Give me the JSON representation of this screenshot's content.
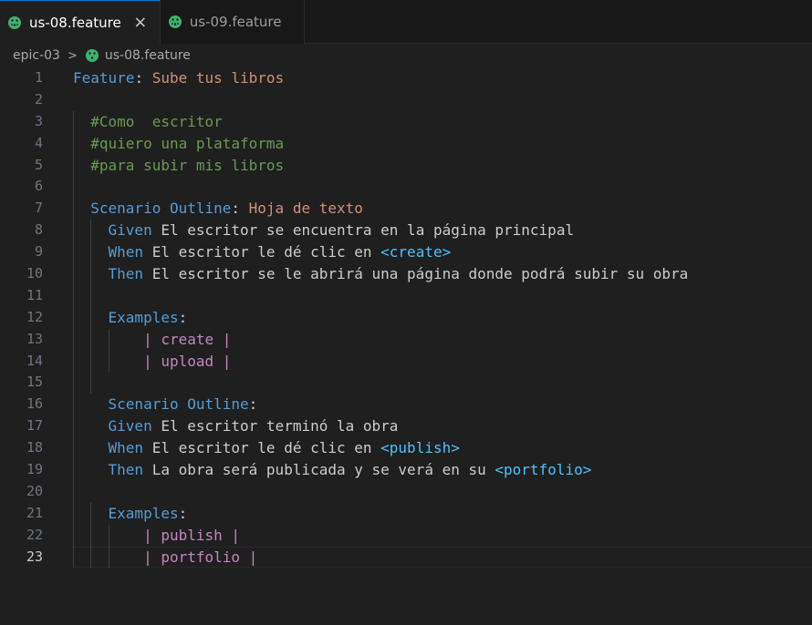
{
  "tabs": [
    {
      "label": "us-08.feature",
      "active": true,
      "close": "×"
    },
    {
      "label": "us-09.feature",
      "active": false
    }
  ],
  "breadcrumb": {
    "folder": "epic-03",
    "separator": ">",
    "file": "us-08.feature"
  },
  "colors": {
    "accent": "#0078d4",
    "keyword": "#569cd6",
    "string": "#ce9178",
    "comment": "#6a9955",
    "placeholder": "#4fc1ff",
    "table": "#c586c0",
    "cucumber_icon": "#3cb371"
  },
  "editor": {
    "current_line": 23,
    "lines": [
      {
        "n": "1",
        "parts": [
          [
            "kw",
            "Feature"
          ],
          [
            "t",
            ": "
          ],
          [
            "title",
            "Sube tus libros"
          ]
        ]
      },
      {
        "n": "2",
        "parts": []
      },
      {
        "n": "3",
        "parts": [
          [
            "t",
            "  "
          ],
          [
            "cmt",
            "#Como  escritor"
          ]
        ]
      },
      {
        "n": "4",
        "parts": [
          [
            "t",
            "  "
          ],
          [
            "cmt",
            "#quiero una plataforma"
          ]
        ]
      },
      {
        "n": "5",
        "parts": [
          [
            "t",
            "  "
          ],
          [
            "cmt",
            "#para subir mis libros"
          ]
        ]
      },
      {
        "n": "6",
        "parts": []
      },
      {
        "n": "7",
        "parts": [
          [
            "t",
            "  "
          ],
          [
            "kw",
            "Scenario Outline"
          ],
          [
            "t",
            ": "
          ],
          [
            "title",
            "Hoja de texto"
          ]
        ]
      },
      {
        "n": "8",
        "parts": [
          [
            "t",
            "    "
          ],
          [
            "kw",
            "Given"
          ],
          [
            "t",
            " El escritor se encuentra en la página principal"
          ]
        ]
      },
      {
        "n": "9",
        "parts": [
          [
            "t",
            "    "
          ],
          [
            "kw",
            "When"
          ],
          [
            "t",
            " El escritor le dé clic en "
          ],
          [
            "ph",
            "<create>"
          ]
        ]
      },
      {
        "n": "10",
        "parts": [
          [
            "t",
            "    "
          ],
          [
            "kw",
            "Then"
          ],
          [
            "t",
            " El escritor se le abrirá una página donde podrá subir su obra"
          ]
        ]
      },
      {
        "n": "11",
        "parts": []
      },
      {
        "n": "12",
        "parts": [
          [
            "t",
            "    "
          ],
          [
            "kw",
            "Examples"
          ],
          [
            "t",
            ":"
          ]
        ]
      },
      {
        "n": "13",
        "parts": [
          [
            "t",
            "        "
          ],
          [
            "pipe",
            "| "
          ],
          [
            "cell",
            "create"
          ],
          [
            "pipe",
            " |"
          ]
        ]
      },
      {
        "n": "14",
        "parts": [
          [
            "t",
            "        "
          ],
          [
            "pipe",
            "| "
          ],
          [
            "cell",
            "upload"
          ],
          [
            "pipe",
            " |"
          ]
        ]
      },
      {
        "n": "15",
        "parts": []
      },
      {
        "n": "16",
        "parts": [
          [
            "t",
            "    "
          ],
          [
            "kw",
            "Scenario Outline"
          ],
          [
            "t",
            ":"
          ]
        ]
      },
      {
        "n": "17",
        "parts": [
          [
            "t",
            "    "
          ],
          [
            "kw",
            "Given"
          ],
          [
            "t",
            " El escritor terminó la obra"
          ]
        ]
      },
      {
        "n": "18",
        "parts": [
          [
            "t",
            "    "
          ],
          [
            "kw",
            "When"
          ],
          [
            "t",
            " El escritor le dé clic en "
          ],
          [
            "ph",
            "<publish>"
          ]
        ]
      },
      {
        "n": "19",
        "parts": [
          [
            "t",
            "    "
          ],
          [
            "kw",
            "Then"
          ],
          [
            "t",
            " La obra será publicada y se verá en su "
          ],
          [
            "ph",
            "<portfolio>"
          ]
        ]
      },
      {
        "n": "20",
        "parts": []
      },
      {
        "n": "21",
        "parts": [
          [
            "t",
            "    "
          ],
          [
            "kw",
            "Examples"
          ],
          [
            "t",
            ":"
          ]
        ]
      },
      {
        "n": "22",
        "parts": [
          [
            "t",
            "        "
          ],
          [
            "pipe",
            "| "
          ],
          [
            "cell",
            "publish"
          ],
          [
            "pipe",
            " |"
          ]
        ]
      },
      {
        "n": "23",
        "parts": [
          [
            "t",
            "        "
          ],
          [
            "pipe",
            "| "
          ],
          [
            "cell",
            "portfolio"
          ],
          [
            "pipe",
            " |"
          ]
        ]
      }
    ]
  }
}
